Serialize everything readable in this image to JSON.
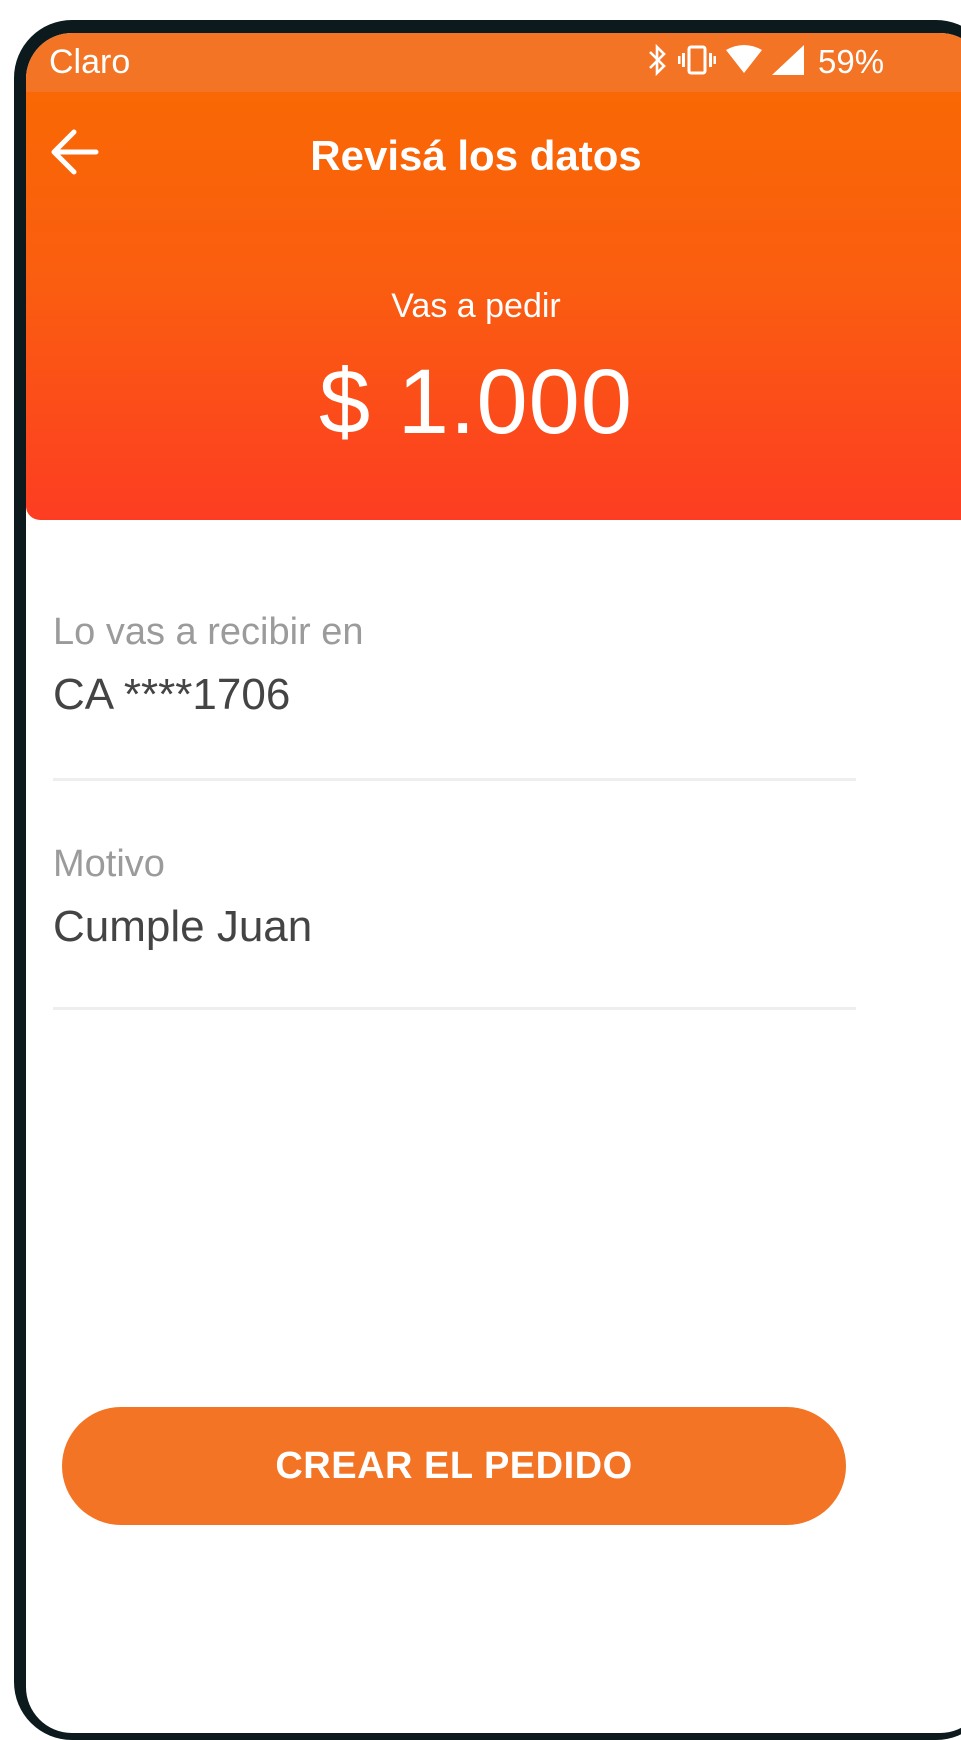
{
  "status_bar": {
    "carrier": "Claro",
    "battery": "59%",
    "icons": [
      "bluetooth-icon",
      "vibrate-icon",
      "wifi-icon",
      "signal-icon"
    ]
  },
  "header": {
    "back_icon": "arrow-left-icon",
    "title": "Revisá los datos",
    "subtitle": "Vas a pedir",
    "amount": "$ 1.000"
  },
  "details": {
    "account_label": "Lo vas a recibir en",
    "account_value": "CA ****1706",
    "reason_label": "Motivo",
    "reason_value": "Cumple Juan"
  },
  "actions": {
    "create_label": "CREAR EL PEDIDO"
  },
  "colors": {
    "accent": "#f37424",
    "header_top": "#f96804",
    "header_bottom": "#fd3d22",
    "label": "#9b9b9b",
    "value": "#444444"
  }
}
